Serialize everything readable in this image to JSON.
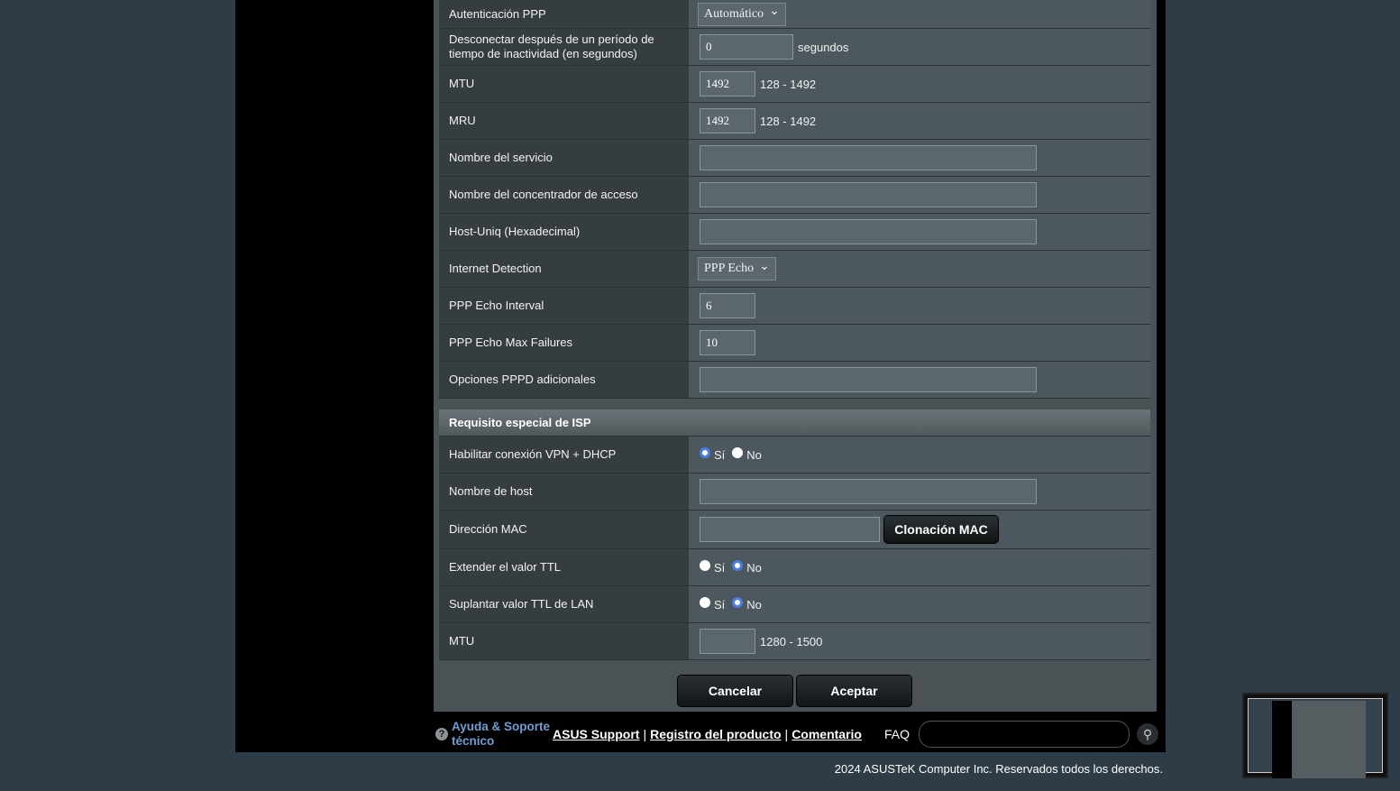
{
  "rows": [
    {
      "label": "Autenticación PPP",
      "type": "select",
      "value": "Automático"
    },
    {
      "label": "Desconectar después de un período de tiempo de inactividad (en segundos)",
      "type": "text",
      "value": "0",
      "width": 104,
      "suffix": "segundos"
    },
    {
      "label": "MTU",
      "type": "text",
      "value": "1492",
      "width": 62,
      "suffix": "128 - 1492"
    },
    {
      "label": "MRU",
      "type": "text",
      "value": "1492",
      "width": 62,
      "suffix": "128 - 1492"
    },
    {
      "label": "Nombre del servicio",
      "type": "text",
      "value": "",
      "width": 374
    },
    {
      "label": "Nombre del concentrador de acceso",
      "type": "text",
      "value": "",
      "width": 374
    },
    {
      "label": "Host-Uniq (Hexadecimal)",
      "type": "text",
      "value": "",
      "width": 374
    },
    {
      "label": "Internet Detection",
      "type": "select",
      "value": "PPP Echo"
    },
    {
      "label": "PPP Echo Interval",
      "type": "text",
      "value": "6",
      "width": 62
    },
    {
      "label": "PPP Echo Max Failures",
      "type": "text",
      "value": "10",
      "width": 62
    },
    {
      "label": "Opciones PPPD adicionales",
      "type": "text",
      "value": "",
      "width": 374
    }
  ],
  "section": {
    "title": "Requisito especial de ISP"
  },
  "isp_rows": [
    {
      "label": "Habilitar conexión VPN + DHCP",
      "type": "radio",
      "options": [
        "Sí",
        "No"
      ],
      "selected": "Sí"
    },
    {
      "label": "Nombre de host",
      "type": "text",
      "value": "",
      "width": 374
    },
    {
      "label": "Dirección MAC",
      "type": "mac",
      "value": "",
      "width": 200,
      "button": "Clonación MAC"
    },
    {
      "label": "Extender el valor TTL",
      "type": "radio",
      "options": [
        "Sí",
        "No"
      ],
      "selected": "No"
    },
    {
      "label": "Suplantar valor TTL de LAN",
      "type": "radio",
      "options": [
        "Sí",
        "No"
      ],
      "selected": "No"
    },
    {
      "label": "MTU",
      "type": "text",
      "value": "",
      "width": 62,
      "suffix": "1280 - 1500"
    }
  ],
  "buttons": {
    "cancel": "Cancelar",
    "apply": "Aceptar"
  },
  "footer": {
    "help_icon": "?",
    "help": "Ayuda & Soporte técnico",
    "links": [
      "ASUS Support",
      "Registro del producto",
      "Comentario"
    ],
    "faq": "FAQ",
    "faq_placeholder": "",
    "search_icon": "⚲"
  },
  "copyright": "2024 ASUSTeK Computer Inc. Reservados todos los derechos.",
  "colors": {
    "background": "#2e3c48",
    "radio_selected": "#4a7ee8",
    "help_link": "#6f9ed3"
  }
}
